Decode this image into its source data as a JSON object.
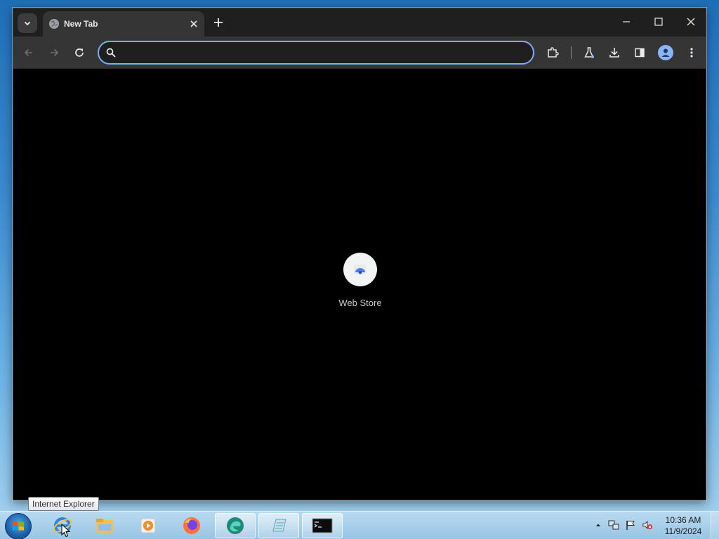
{
  "browser": {
    "tab": {
      "title": "New Tab",
      "favicon": "globe-icon"
    },
    "omnibox": {
      "value": "",
      "placeholder": ""
    },
    "toolbar_icons": [
      "back-icon",
      "forward-icon",
      "reload-icon",
      "search-icon",
      "extensions-icon",
      "labs-flask-icon",
      "download-icon",
      "side-panel-icon",
      "profile-icon",
      "menu-icon"
    ],
    "window_controls": [
      "minimize-icon",
      "maximize-icon",
      "close-icon"
    ],
    "accent_color": "#7cacf8"
  },
  "new_tab_page": {
    "shortcuts": [
      {
        "label": "Web Store",
        "icon": "web-store-icon"
      }
    ]
  },
  "taskbar": {
    "tooltip": "Internet Explorer",
    "pinned": [
      "internet-explorer-icon",
      "file-explorer-icon",
      "media-player-icon",
      "firefox-icon",
      "edge-icon",
      "notepad-icon",
      "command-prompt-icon"
    ],
    "tray_icons": [
      "show-hidden-icons-icon",
      "network-icon",
      "action-center-flag-icon",
      "volume-muted-icon"
    ],
    "clock": {
      "time": "10:36 AM",
      "date": "11/9/2024"
    }
  }
}
